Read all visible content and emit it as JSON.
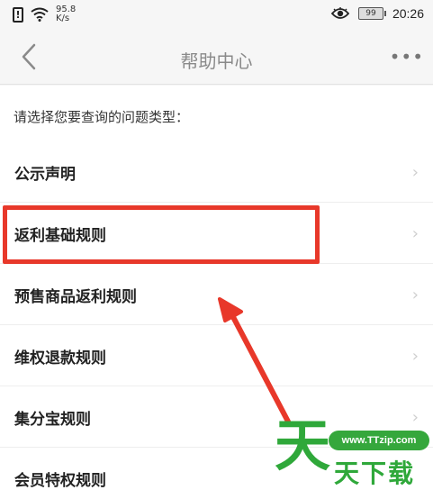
{
  "status_bar": {
    "alert_glyph": "!",
    "network_speed_value": "95.8",
    "network_speed_unit": "K/s",
    "battery": "99",
    "time": "20:26"
  },
  "nav": {
    "title": "帮助中心",
    "more_glyph": "•••"
  },
  "prompt": "请选择您要查询的问题类型：",
  "items": [
    {
      "label": "公示声明"
    },
    {
      "label": "返利基础规则"
    },
    {
      "label": "预售商品返利规则"
    },
    {
      "label": "维权退款规则"
    },
    {
      "label": "集分宝规则"
    },
    {
      "label": "会员特权规则"
    }
  ],
  "chevron_glyph": "›",
  "watermark": {
    "url": "www.TTzip.com",
    "big_char": "天",
    "small_text": "天下载"
  },
  "colors": {
    "highlight": "#e8382a",
    "watermark": "#2fa83a"
  }
}
